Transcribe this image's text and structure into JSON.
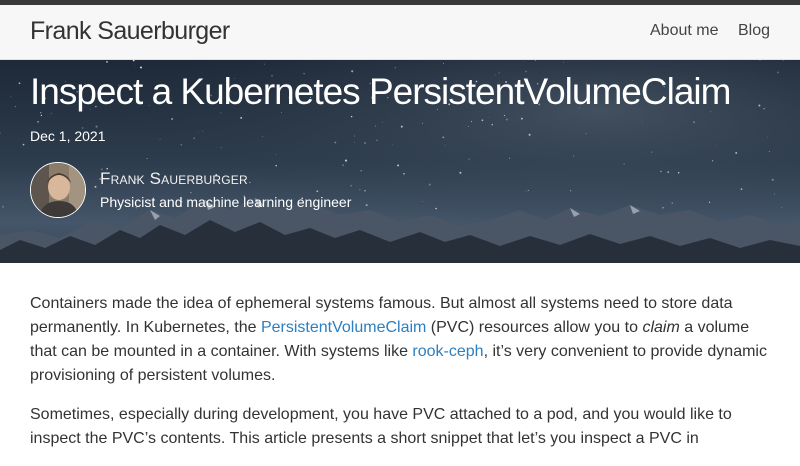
{
  "navbar": {
    "brand": "Frank Sauerburger",
    "links": [
      "About me",
      "Blog"
    ]
  },
  "header": {
    "title": "Inspect a Kubernetes PersistentVolumeClaim",
    "date": "Dec 1, 2021",
    "author_name": "Frank Sauerburger",
    "author_role": "Physicist and machine learning engineer"
  },
  "article": {
    "p1": {
      "t1": "Containers made the idea of ephemeral systems famous. But almost all systems need to store data permanently. In Kubernetes, the ",
      "link1": "PersistentVolumeClaim",
      "t2": " (PVC) resources allow you to ",
      "em": "claim",
      "t3": " a volume that can be mounted in a container. With systems like ",
      "link2": "rook-ceph",
      "t4": ", it’s very convenient to provide dynamic provisioning of persistent volumes."
    },
    "p2": "Sometimes, especially during development, you have PVC attached to a pod, and you would like to inspect the PVC’s contents. This article presents a short snippet that let’s you inspect a PVC in"
  },
  "colors": {
    "link": "#2c7fc0",
    "text": "#333333",
    "navbar_bg": "#f7f7f7"
  }
}
